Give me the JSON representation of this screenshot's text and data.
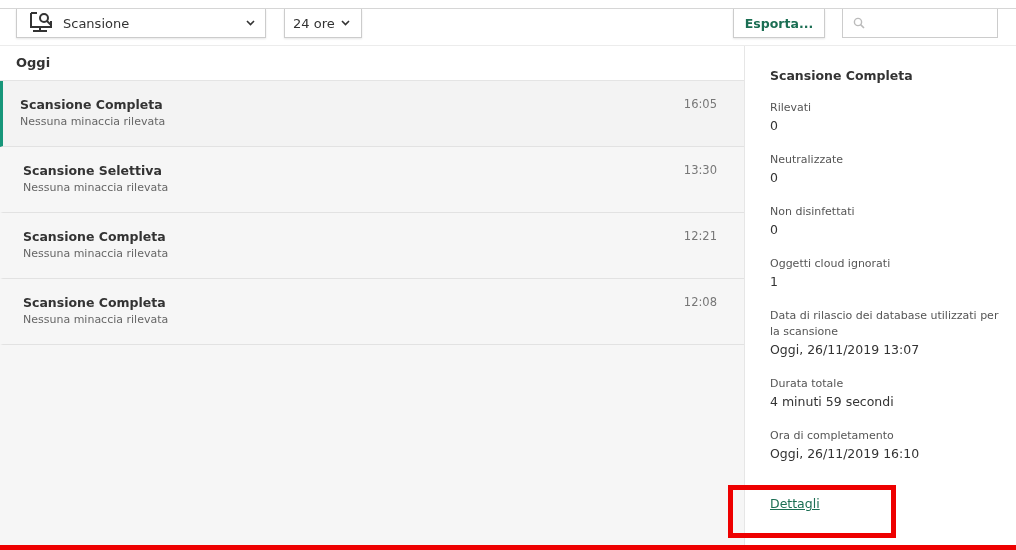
{
  "toolbar": {
    "category": "Scansione",
    "period": "24 ore",
    "export_button": "Esporta..."
  },
  "list": {
    "group_label": "Oggi",
    "items": [
      {
        "title": "Scansione Completa",
        "subtitle": "Nessuna minaccia rilevata",
        "time": "16:05",
        "selected": true
      },
      {
        "title": "Scansione Selettiva",
        "subtitle": "Nessuna minaccia rilevata",
        "time": "13:30",
        "selected": false
      },
      {
        "title": "Scansione Completa",
        "subtitle": "Nessuna minaccia rilevata",
        "time": "12:21",
        "selected": false
      },
      {
        "title": "Scansione Completa",
        "subtitle": "Nessuna minaccia rilevata",
        "time": "12:08",
        "selected": false
      }
    ]
  },
  "details": {
    "title": "Scansione Completa",
    "fields": [
      {
        "label": "Rilevati",
        "value": "0"
      },
      {
        "label": "Neutralizzate",
        "value": "0"
      },
      {
        "label": "Non disinfettati",
        "value": "0"
      },
      {
        "label": "Oggetti cloud ignorati",
        "value": "1"
      },
      {
        "label": "Data di rilascio dei database utilizzati per la scansione",
        "value": "Oggi, 26/11/2019 13:07"
      },
      {
        "label": "Durata totale",
        "value": "4 minuti 59 secondi"
      },
      {
        "label": "Ora di completamento",
        "value": "Oggi, 26/11/2019 16:10"
      }
    ],
    "link": "Dettagli"
  }
}
